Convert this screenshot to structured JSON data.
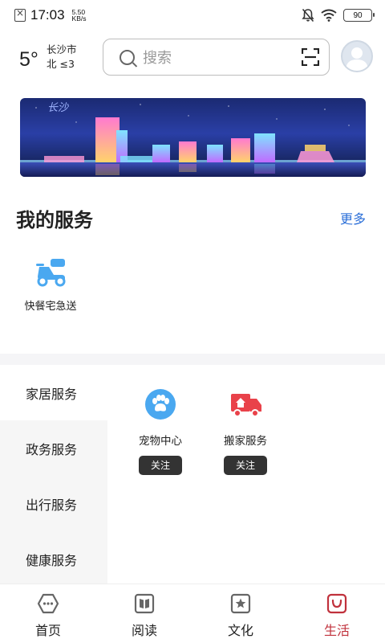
{
  "status_bar": {
    "time": "17:03",
    "net_speed_value": "5.50",
    "net_speed_unit": "KB/s",
    "battery": "90"
  },
  "header": {
    "temperature": "5°",
    "city": "长沙市",
    "wind": "北 ≤3",
    "search_placeholder": "搜索"
  },
  "banner": {
    "overlay_text": "长沙"
  },
  "my_services": {
    "title": "我的服务",
    "more_label": "更多",
    "items": [
      {
        "label": "快餐宅急送",
        "icon": "scooter-icon"
      }
    ]
  },
  "categories": {
    "items": [
      {
        "label": "家居服务",
        "active": true
      },
      {
        "label": "政务服务",
        "active": false
      },
      {
        "label": "出行服务",
        "active": false
      },
      {
        "label": "健康服务",
        "active": false
      }
    ]
  },
  "category_content": {
    "items": [
      {
        "label": "宠物中心",
        "button": "关注",
        "icon": "paw-icon",
        "color": "#4aa8f0"
      },
      {
        "label": "搬家服务",
        "button": "关注",
        "icon": "moving-truck-icon",
        "color": "#e9424a"
      }
    ]
  },
  "bottom_nav": {
    "items": [
      {
        "label": "首页",
        "icon": "home-chat-icon",
        "active": false
      },
      {
        "label": "阅读",
        "icon": "book-icon",
        "active": false
      },
      {
        "label": "文化",
        "icon": "star-box-icon",
        "active": false
      },
      {
        "label": "生活",
        "icon": "bag-icon",
        "active": true
      }
    ]
  },
  "colors": {
    "accent_link": "#2b6fd8",
    "active_nav": "#c0313c",
    "service_blue": "#4aa8f0",
    "moving_red": "#e9424a"
  }
}
